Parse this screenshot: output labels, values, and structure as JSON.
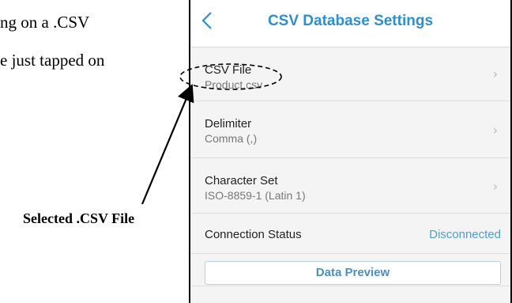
{
  "document": {
    "line1": "ng on a .CSV",
    "line2": "e just tapped on",
    "callout_label": "Selected .CSV File"
  },
  "app": {
    "title": "CSV Database Settings",
    "back_icon": "chevron-left-icon",
    "accent_color": "#2b8fd6",
    "rows": [
      {
        "label": "CSV File",
        "value": "Product.csv"
      },
      {
        "label": "Delimiter",
        "value": "Comma (,)"
      },
      {
        "label": "Character Set",
        "value": "ISO-8859-1 (Latin 1)"
      }
    ],
    "connection": {
      "label": "Connection Status",
      "status": "Disconnected"
    },
    "preview_button": "Data Preview"
  }
}
